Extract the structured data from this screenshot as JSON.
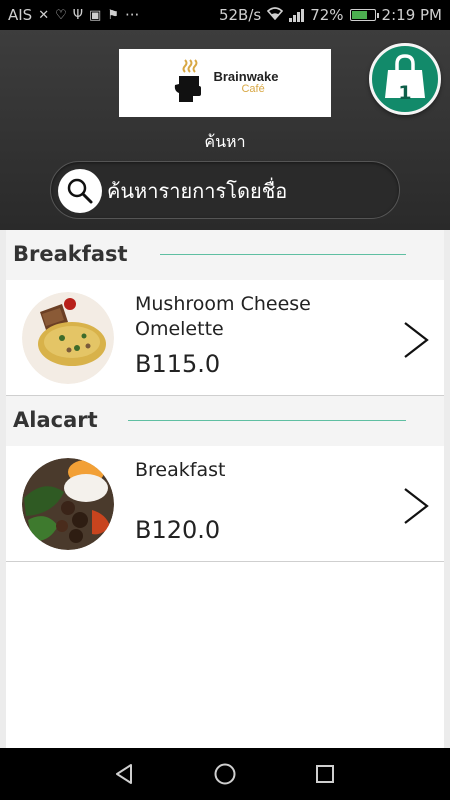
{
  "status_bar": {
    "carrier": "AIS",
    "speed": "52B/s",
    "battery": "72%",
    "battery_level": 0.72,
    "time": "2:19 PM",
    "more": "···"
  },
  "header": {
    "logo_brand": "Brainwake",
    "logo_sub": "Café",
    "label": "ค้นหา",
    "cart_count": "1",
    "search_placeholder": "ค้นหารายการโดยชื่อ"
  },
  "sections": [
    {
      "title": "Breakfast",
      "items": [
        {
          "name": "Mushroom Cheese Omelette",
          "price": "B115.0"
        }
      ]
    },
    {
      "title": "Alacart",
      "items": [
        {
          "name": "Breakfast",
          "price": "B120.0"
        }
      ]
    }
  ],
  "colors": {
    "accent": "#128a6a",
    "section_line": "#5fbfa2",
    "header_bg": "#333333"
  }
}
